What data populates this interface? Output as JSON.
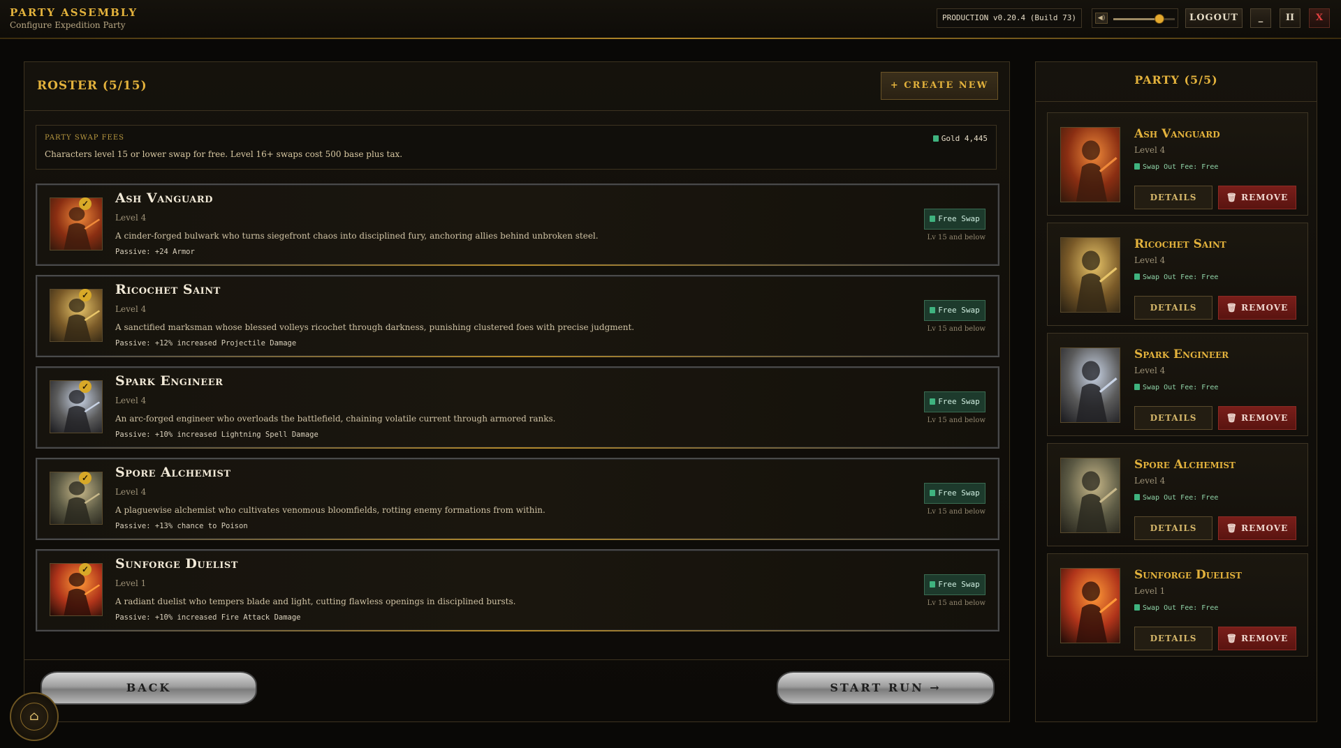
{
  "header": {
    "title": "PARTY ASSEMBLY",
    "subtitle": "Configure Expedition Party",
    "build": "PRODUCTION v0.20.4 (Build 73)",
    "volume_percent": 75,
    "logout_label": "LOGOUT",
    "minimize_label": "_",
    "pause_label": "II",
    "close_label": "X"
  },
  "roster": {
    "title": "ROSTER (5/15)",
    "create_label": "CREATE NEW",
    "create_icon": "+",
    "fees_label": "PARTY SWAP FEES",
    "fees_text": "Characters level 15 or lower swap for free. Level 16+ swaps cost 500 base plus tax.",
    "gold": "Gold 4,445",
    "items": [
      {
        "name": "Ash Vanguard",
        "level": "Level 4",
        "desc": "A cinder-forged bulwark who turns siegefront chaos into disciplined fury, anchoring allies behind unbroken steel.",
        "passive": "Passive: +24 Armor",
        "swap": "Free Swap",
        "swap_sub": "Lv 15 and below"
      },
      {
        "name": "Ricochet Saint",
        "level": "Level 4",
        "desc": "A sanctified marksman whose blessed volleys ricochet through darkness, punishing clustered foes with precise judgment.",
        "passive": "Passive: +12% increased Projectile Damage",
        "swap": "Free Swap",
        "swap_sub": "Lv 15 and below"
      },
      {
        "name": "Spark Engineer",
        "level": "Level 4",
        "desc": "An arc-forged engineer who overloads the battlefield, chaining volatile current through armored ranks.",
        "passive": "Passive: +10% increased Lightning Spell Damage",
        "swap": "Free Swap",
        "swap_sub": "Lv 15 and below"
      },
      {
        "name": "Spore Alchemist",
        "level": "Level 4",
        "desc": "A plaguewise alchemist who cultivates venomous bloomfields, rotting enemy formations from within.",
        "passive": "Passive: +13% chance to Poison",
        "swap": "Free Swap",
        "swap_sub": "Lv 15 and below"
      },
      {
        "name": "Sunforge Duelist",
        "level": "Level 1",
        "desc": "A radiant duelist who tempers blade and light, cutting flawless openings in disciplined bursts.",
        "passive": "Passive: +10% increased Fire Attack Damage",
        "swap": "Free Swap",
        "swap_sub": "Lv 15 and below"
      }
    ],
    "back_label": "BACK",
    "start_label": "START RUN →"
  },
  "party": {
    "title": "PARTY (5/5)",
    "fee_text": "Swap Out Fee: Free",
    "details_label": "DETAILS",
    "remove_label": "REMOVE",
    "members": [
      {
        "name": "Ash Vanguard",
        "level": "Level 4"
      },
      {
        "name": "Ricochet Saint",
        "level": "Level 4"
      },
      {
        "name": "Spark Engineer",
        "level": "Level 4"
      },
      {
        "name": "Spore Alchemist",
        "level": "Level 4"
      },
      {
        "name": "Sunforge Duelist",
        "level": "Level 1"
      }
    ]
  },
  "icons": {
    "volume": "speaker-icon",
    "coin": "coin-icon",
    "trash": "trash-icon",
    "check": "check-icon",
    "codex": "codex-icon"
  },
  "colors": {
    "accent": "#e3b23c",
    "swap": "#1d3a2c",
    "remove": "#7a1e1a"
  }
}
